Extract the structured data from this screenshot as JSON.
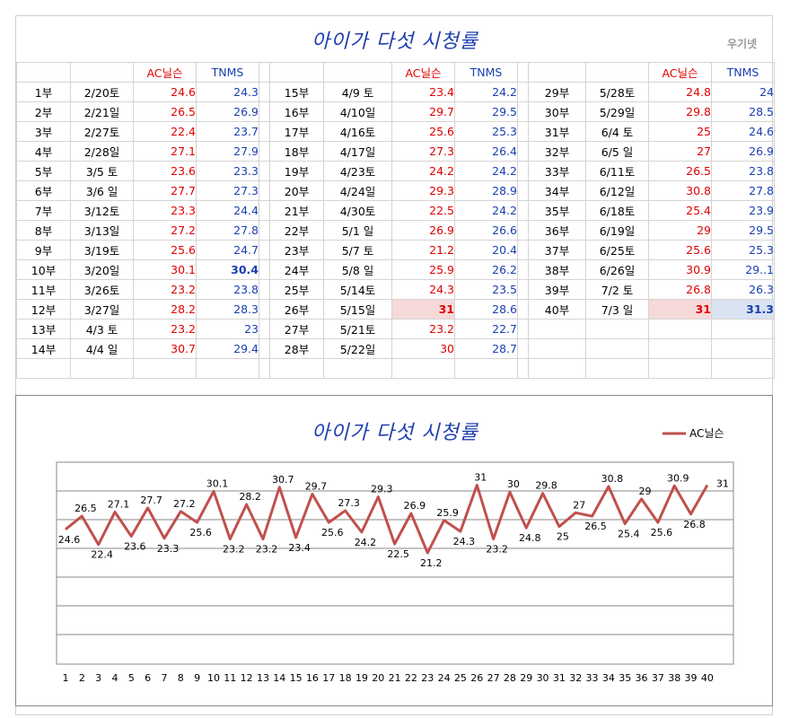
{
  "title_top": "아이가 다섯 시청률",
  "watermark": "우기넷",
  "headers": {
    "ac": "AC닐슨",
    "tnms": "TNMS"
  },
  "episodes": [
    {
      "ep": "1부",
      "date": "2/20토",
      "ac": "24.6",
      "tnms": "24.3"
    },
    {
      "ep": "2부",
      "date": "2/21일",
      "ac": "26.5",
      "tnms": "26.9"
    },
    {
      "ep": "3부",
      "date": "2/27토",
      "ac": "22.4",
      "tnms": "23.7"
    },
    {
      "ep": "4부",
      "date": "2/28일",
      "ac": "27.1",
      "tnms": "27.9"
    },
    {
      "ep": "5부",
      "date": "3/5 토",
      "ac": "23.6",
      "tnms": "23.3"
    },
    {
      "ep": "6부",
      "date": "3/6 일",
      "ac": "27.7",
      "tnms": "27.3"
    },
    {
      "ep": "7부",
      "date": "3/12토",
      "ac": "23.3",
      "tnms": "24.4"
    },
    {
      "ep": "8부",
      "date": "3/13일",
      "ac": "27.2",
      "tnms": "27.8"
    },
    {
      "ep": "9부",
      "date": "3/19토",
      "ac": "25.6",
      "tnms": "24.7"
    },
    {
      "ep": "10부",
      "date": "3/20일",
      "ac": "30.1",
      "tnms": "30.4"
    },
    {
      "ep": "11부",
      "date": "3/26토",
      "ac": "23.2",
      "tnms": "23.8"
    },
    {
      "ep": "12부",
      "date": "3/27일",
      "ac": "28.2",
      "tnms": "28.3"
    },
    {
      "ep": "13부",
      "date": "4/3 토",
      "ac": "23.2",
      "tnms": "23"
    },
    {
      "ep": "14부",
      "date": "4/4 일",
      "ac": "30.7",
      "tnms": "29.4"
    },
    {
      "ep": "15부",
      "date": "4/9 토",
      "ac": "23.4",
      "tnms": "24.2"
    },
    {
      "ep": "16부",
      "date": "4/10일",
      "ac": "29.7",
      "tnms": "29.5"
    },
    {
      "ep": "17부",
      "date": "4/16토",
      "ac": "25.6",
      "tnms": "25.3"
    },
    {
      "ep": "18부",
      "date": "4/17일",
      "ac": "27.3",
      "tnms": "26.4"
    },
    {
      "ep": "19부",
      "date": "4/23토",
      "ac": "24.2",
      "tnms": "24.2"
    },
    {
      "ep": "20부",
      "date": "4/24일",
      "ac": "29.3",
      "tnms": "28.9"
    },
    {
      "ep": "21부",
      "date": "4/30토",
      "ac": "22.5",
      "tnms": "24.2"
    },
    {
      "ep": "22부",
      "date": "5/1 일",
      "ac": "26.9",
      "tnms": "26.6"
    },
    {
      "ep": "23부",
      "date": "5/7 토",
      "ac": "21.2",
      "tnms": "20.4"
    },
    {
      "ep": "24부",
      "date": "5/8 일",
      "ac": "25.9",
      "tnms": "26.2"
    },
    {
      "ep": "25부",
      "date": "5/14토",
      "ac": "24.3",
      "tnms": "23.5"
    },
    {
      "ep": "26부",
      "date": "5/15일",
      "ac": "31",
      "tnms": "28.6"
    },
    {
      "ep": "27부",
      "date": "5/21토",
      "ac": "23.2",
      "tnms": "22.7"
    },
    {
      "ep": "28부",
      "date": "5/22일",
      "ac": "30",
      "tnms": "28.7"
    },
    {
      "ep": "29부",
      "date": "5/28토",
      "ac": "24.8",
      "tnms": "24"
    },
    {
      "ep": "30부",
      "date": "5/29일",
      "ac": "29.8",
      "tnms": "28.5"
    },
    {
      "ep": "31부",
      "date": "6/4 토",
      "ac": "25",
      "tnms": "24.6"
    },
    {
      "ep": "32부",
      "date": "6/5 일",
      "ac": "27",
      "tnms": "26.9"
    },
    {
      "ep": "33부",
      "date": "6/11토",
      "ac": "26.5",
      "tnms": "23.8"
    },
    {
      "ep": "34부",
      "date": "6/12일",
      "ac": "30.8",
      "tnms": "27.8"
    },
    {
      "ep": "35부",
      "date": "6/18토",
      "ac": "25.4",
      "tnms": "23.9"
    },
    {
      "ep": "36부",
      "date": "6/19일",
      "ac": "29",
      "tnms": "29.5"
    },
    {
      "ep": "37부",
      "date": "6/25토",
      "ac": "25.6",
      "tnms": "25.3"
    },
    {
      "ep": "38부",
      "date": "6/26일",
      "ac": "30.9",
      "tnms": "29..1"
    },
    {
      "ep": "39부",
      "date": "7/2 토",
      "ac": "26.8",
      "tnms": "26.3"
    },
    {
      "ep": "40부",
      "date": "7/3 일",
      "ac": "31",
      "tnms": "31.3"
    }
  ],
  "highlights": {
    "bold_tnms": [
      "10부",
      "40부"
    ],
    "bold_ac": [
      "26부",
      "40부"
    ],
    "fill_ac": [
      "26부",
      "40부"
    ],
    "fill_tnms": [
      "40부"
    ],
    "fill_ac_color": "#f6d9d9",
    "fill_tnms_color": "#d9e3f1"
  },
  "chart_data": {
    "type": "line",
    "title": "아이가 다섯 시청률",
    "legend": "top-right",
    "series": [
      {
        "name": "AC닐슨",
        "color": "#c0504d",
        "values": [
          24.6,
          26.5,
          22.4,
          27.1,
          23.6,
          27.7,
          23.3,
          27.2,
          25.6,
          30.1,
          23.2,
          28.2,
          23.2,
          30.7,
          23.4,
          29.7,
          25.6,
          27.3,
          24.2,
          29.3,
          22.5,
          26.9,
          21.2,
          25.9,
          24.3,
          31,
          23.2,
          30,
          24.8,
          29.8,
          25,
          27,
          26.5,
          30.8,
          25.4,
          29,
          25.6,
          30.9,
          26.8,
          31
        ]
      }
    ],
    "x": [
      1,
      2,
      3,
      4,
      5,
      6,
      7,
      8,
      9,
      10,
      11,
      12,
      13,
      14,
      15,
      16,
      17,
      18,
      19,
      20,
      21,
      22,
      23,
      24,
      25,
      26,
      27,
      28,
      29,
      30,
      31,
      32,
      33,
      34,
      35,
      36,
      37,
      38,
      39,
      40
    ],
    "grid": true
  }
}
